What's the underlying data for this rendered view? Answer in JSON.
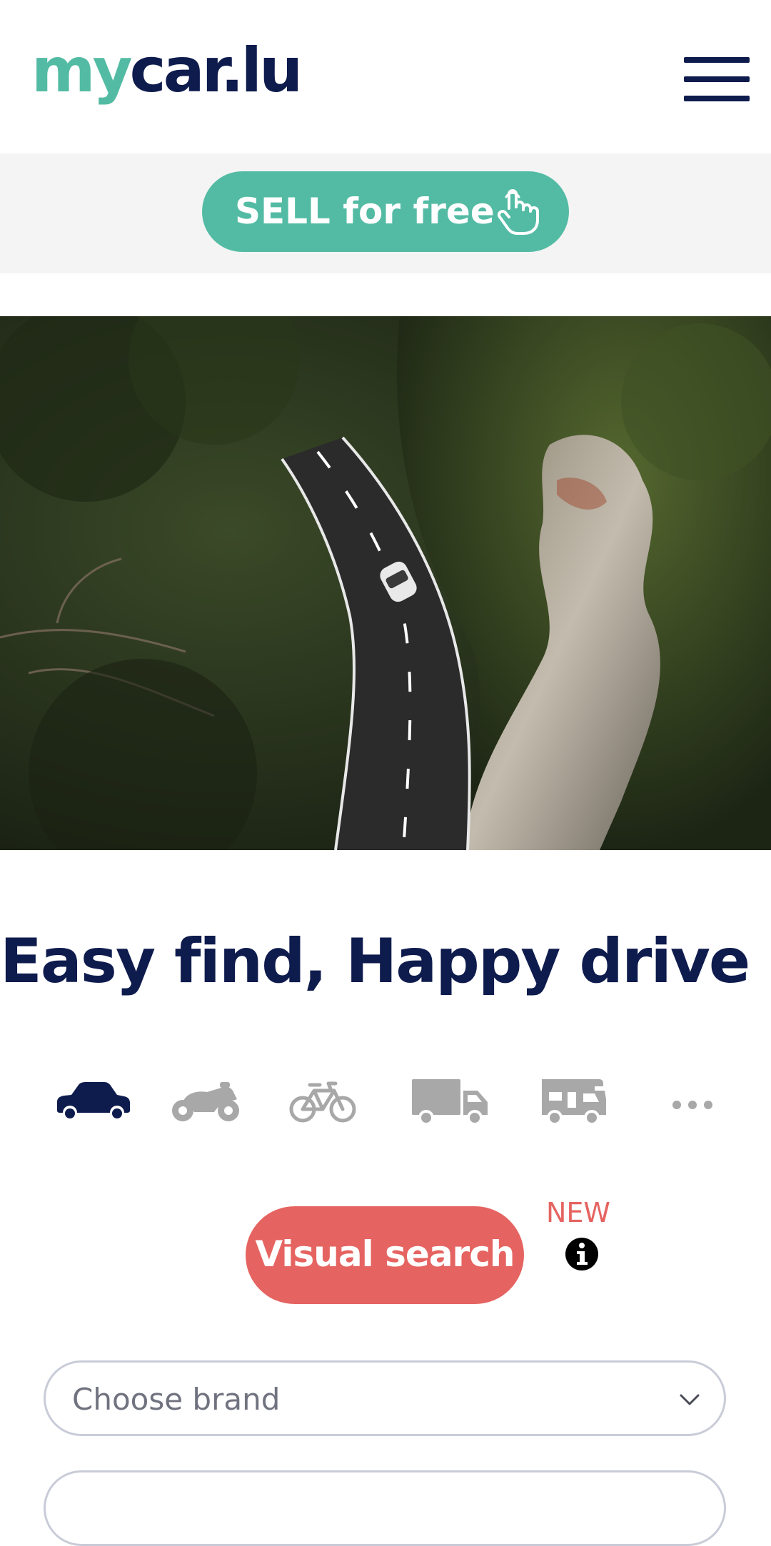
{
  "header": {
    "logo_my": "my",
    "logo_rest": "car.lu",
    "menu_icon": "hamburger-menu-icon"
  },
  "sell": {
    "label": "SELL for free",
    "icon": "pointing-hand-icon"
  },
  "hero": {
    "image": "aerial photo of a winding road through forest with a white car"
  },
  "headline": "Easy find, Happy drive !",
  "vehicle_types": {
    "items": [
      {
        "icon": "car-icon",
        "selected": true
      },
      {
        "icon": "motorcycle-icon",
        "selected": false
      },
      {
        "icon": "bicycle-icon",
        "selected": false
      },
      {
        "icon": "truck-icon",
        "selected": false
      },
      {
        "icon": "camper-van-icon",
        "selected": false
      },
      {
        "icon": "more-icon",
        "selected": false
      }
    ]
  },
  "visual_search": {
    "label": "Visual search",
    "badge": "NEW",
    "info_icon": "info-icon"
  },
  "search_form": {
    "brand_placeholder": "Choose brand"
  },
  "colors": {
    "brand_green": "#53bba4",
    "brand_navy": "#0e1b4d",
    "accent_red": "#e56461",
    "inactive_icon": "#a8a8a8",
    "bar_bg": "#f4f4f4"
  }
}
